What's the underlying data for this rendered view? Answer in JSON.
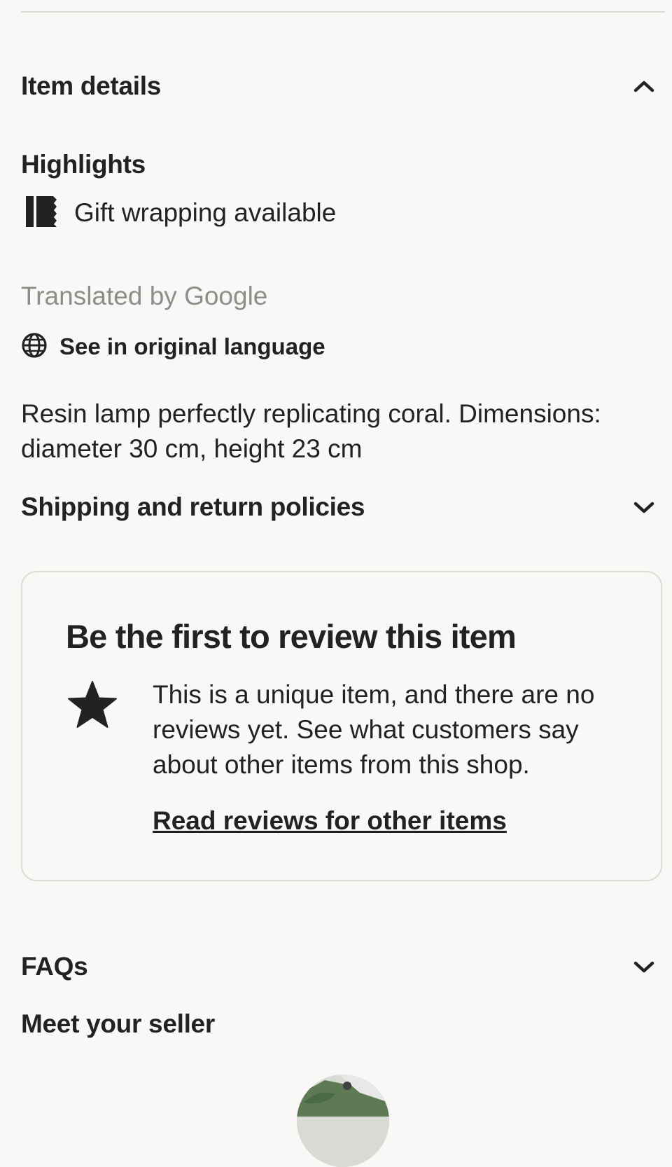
{
  "item_details": {
    "title": "Item details",
    "highlights_heading": "Highlights",
    "highlight_gift": "Gift wrapping available",
    "translated_note": "Translated by Google",
    "original_language_link": "See in original language",
    "description": "Resin lamp perfectly replicating coral. Dimensions: diameter 30 cm, height 23 cm"
  },
  "shipping": {
    "title": "Shipping and return policies"
  },
  "review_card": {
    "title": "Be the first to review this item",
    "body": "This is a unique item, and there are no reviews yet. See what customers say about other items from this shop.",
    "link": "Read reviews for other items"
  },
  "faqs": {
    "title": "FAQs"
  },
  "seller": {
    "title": "Meet your seller"
  },
  "icons": {
    "item_details_toggle": "chevron-up-icon",
    "highlight": "gift-wrap-icon",
    "language": "globe-icon",
    "shipping_toggle": "chevron-down-icon",
    "review": "star-icon",
    "faqs_toggle": "chevron-down-icon"
  },
  "colors": {
    "background": "#f9f8f6",
    "text": "#222222",
    "muted_text": "#8f8d89",
    "border": "#dedbd5"
  }
}
